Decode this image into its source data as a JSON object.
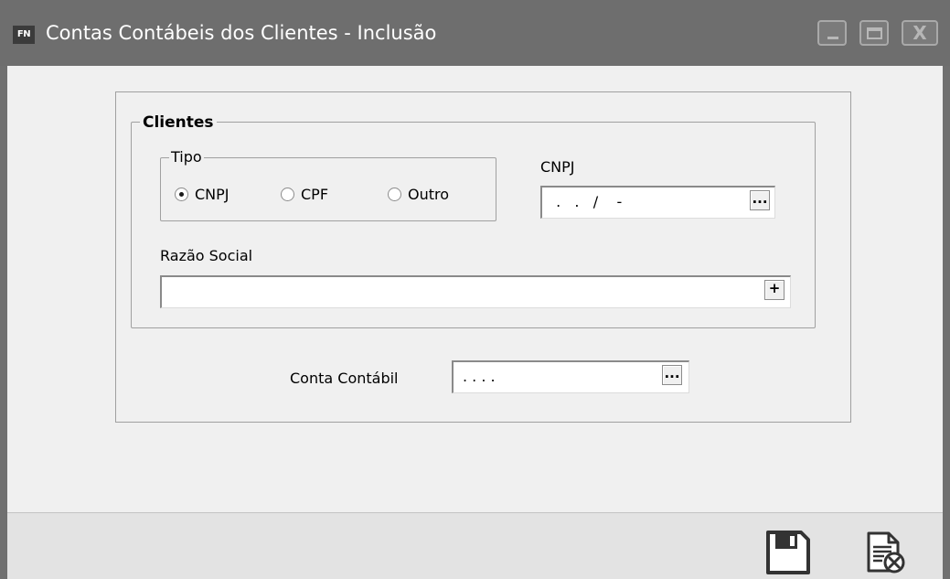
{
  "window": {
    "app_icon_text": "FN",
    "title": "Contas Contábeis dos Clientes - Inclusão",
    "controls": [
      "minimize-icon",
      "maximize-icon",
      "close-icon"
    ],
    "close_glyph": "X"
  },
  "clientes": {
    "group_title": "Clientes",
    "tipo": {
      "title": "Tipo",
      "options": [
        {
          "label": "CNPJ",
          "selected": true
        },
        {
          "label": "CPF",
          "selected": false
        },
        {
          "label": "Outro",
          "selected": false
        }
      ]
    },
    "cnpj": {
      "label": "CNPJ",
      "value": " .   .   /    -",
      "button": "..."
    },
    "razao_social": {
      "label": "Razão Social",
      "value": "",
      "button": "+"
    }
  },
  "conta_contabil": {
    "label": "Conta Contábil",
    "value": ". . . .",
    "button": "..."
  },
  "toolbar": {
    "icons": [
      "save-icon",
      "cancel-document-icon"
    ]
  },
  "colors": {
    "titlebar": "#6e6e6e",
    "background": "#f0f0f0",
    "footer": "#e3e3e3"
  }
}
